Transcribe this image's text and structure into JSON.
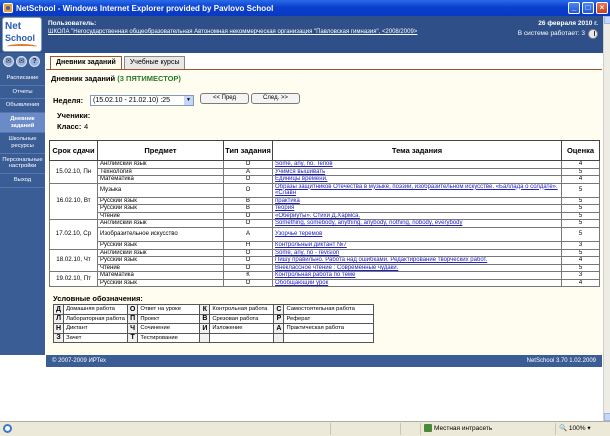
{
  "window": {
    "title": "NetSchool - Windows Internet Explorer provided by Pavlovo School",
    "minimize": "_",
    "maximize": "□",
    "close": "×"
  },
  "header": {
    "logo_line1": "Net",
    "logo_line2": "School",
    "user_label": "Пользователь:",
    "school_name": "ШКОЛА \"Негосударственная общеобразовательная Автономная некоммерческая организация \"Павловская гимназия\", <2008/2009>",
    "date": "26 февраля 2010 г.",
    "online_text": "В системе работает: 3"
  },
  "sidebar": {
    "icons": [
      "✉",
      "✉",
      "?"
    ],
    "items": [
      {
        "label": "Расписание"
      },
      {
        "label": "Отчеты"
      },
      {
        "label": "Объявления"
      },
      {
        "label": "Дневник заданий",
        "active": true
      },
      {
        "label": "Школьные ресурсы"
      },
      {
        "label": "Персональные настройки"
      },
      {
        "label": "Выход"
      }
    ]
  },
  "tabs": [
    {
      "label": "Дневник заданий",
      "active": true
    },
    {
      "label": "Учебные курсы",
      "active": false
    }
  ],
  "main": {
    "heading": "Дневник заданий",
    "period": "(3 ПЯТИМЕСТОР)",
    "week_label": "Неделя:",
    "week_value": "(15.02.10 - 21.02.10) :25",
    "prev_button": "<< Пред",
    "next_button": "След. >>",
    "students_label": "Ученики:",
    "class_label": "Класс:",
    "class_value": "4"
  },
  "table": {
    "headers": [
      "Срок сдачи",
      "Предмет",
      "Тип задания",
      "Тема задания",
      "Оценка"
    ],
    "groups": [
      {
        "date": "15.02.10, Пн",
        "rows": [
          {
            "subject": "Английский язык",
            "type": "О",
            "topic": "Some, any, no. Teпов",
            "mark": "4"
          },
          {
            "subject": "Технология",
            "type": "А",
            "topic": "Учимся вышивать",
            "mark": "5"
          },
          {
            "subject": "Математика",
            "type": "О",
            "topic": "Единицы времени.",
            "mark": "4"
          }
        ]
      },
      {
        "date": "16.02.10, Вт",
        "rows": [
          {
            "subject": "Музыка",
            "type": "О",
            "topic": "Образы защитников Отечества в музыке, поэзии, изобразительном искусстве. «Баллада о солдате». «Славн",
            "mark": "5",
            "wrap": true
          },
          {
            "subject": "Русский язык",
            "type": "В",
            "topic": "практика",
            "mark": "5"
          },
          {
            "subject": "Русский язык",
            "type": "В",
            "topic": "теория",
            "mark": "5"
          },
          {
            "subject": "Чтение",
            "type": "О",
            "topic": "«Обериуты». Стихи Д.Хармса.",
            "mark": "5"
          }
        ]
      },
      {
        "date": "17.02.10, Ср",
        "rows": [
          {
            "subject": "Английский язык",
            "type": "О",
            "topic": "Something, somebody, anything, anybody, nothing, nobody, everybody",
            "mark": "5"
          },
          {
            "subject": "Изобразительное искусство",
            "type": "А",
            "topic": "Узорчье теремов",
            "mark": "5",
            "wrap": true
          },
          {
            "subject": "Русский язык",
            "type": "Н",
            "topic": "Контрольный диктант №7",
            "mark": "3"
          }
        ]
      },
      {
        "date": "18.02.10, Чт",
        "rows": [
          {
            "subject": "Английский язык",
            "type": "О",
            "topic": "Some, any, no - revision",
            "mark": "5"
          },
          {
            "subject": "Русский язык",
            "type": "О",
            "topic": "Пишу правильно. Работа над ошибками. Редактирование творческих работ.",
            "mark": "4"
          },
          {
            "subject": "Чтение",
            "type": "О",
            "topic": "Внеклассное чтение : Современные чудаки.",
            "mark": "5"
          }
        ]
      },
      {
        "date": "19.02.10, Пт",
        "rows": [
          {
            "subject": "Математика",
            "type": "К",
            "topic": "Контрольная работа по теме",
            "mark": "3"
          },
          {
            "subject": "Русский язык",
            "type": "О",
            "topic": "Обобщающий урок",
            "mark": "4"
          }
        ]
      }
    ]
  },
  "legend": {
    "title": "Условные обозначения:",
    "rows": [
      [
        [
          "Д",
          "Домашняя работа"
        ],
        [
          "О",
          "Ответ на уроке"
        ],
        [
          "К",
          "Контрольная работа"
        ],
        [
          "С",
          "Самостоятельная работа"
        ]
      ],
      [
        [
          "Л",
          "Лабораторная работа"
        ],
        [
          "П",
          "Проект"
        ],
        [
          "В",
          "Срезовая работа"
        ],
        [
          "Р",
          "Реферат"
        ]
      ],
      [
        [
          "Н",
          "Диктант"
        ],
        [
          "Ч",
          "Сочинение"
        ],
        [
          "И",
          "Изложение"
        ],
        [
          "А",
          "Практическая работа"
        ]
      ],
      [
        [
          "З",
          "Зачет"
        ],
        [
          "Т",
          "Тестирование"
        ],
        [
          "",
          ""
        ],
        [
          "",
          ""
        ]
      ]
    ]
  },
  "footer": {
    "copyright": "© 2007-2009 ИРТех",
    "version": "NetSchool 3.70  1.02.2009"
  },
  "statusbar": {
    "zone": "Местная интрасеть",
    "zoom": "100%"
  }
}
